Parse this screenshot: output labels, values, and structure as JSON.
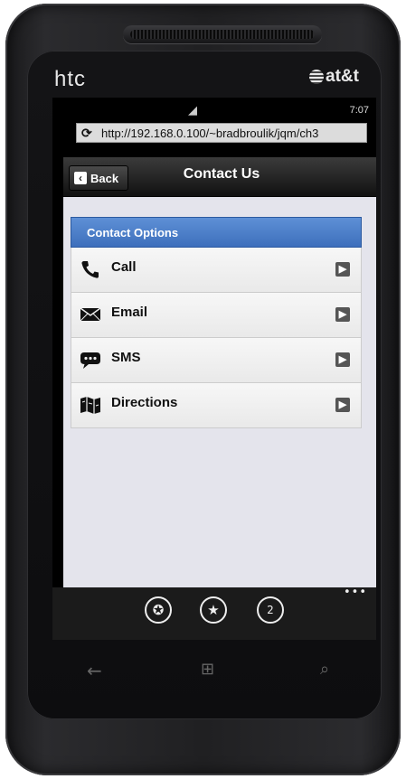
{
  "device": {
    "brand_left": "htc",
    "brand_right": "at&t"
  },
  "status": {
    "time": "7:07"
  },
  "browser": {
    "url": "http://192.168.0.100/~bradbroulik/jqm/ch3"
  },
  "header": {
    "back_label": "Back",
    "title": "Contact Us"
  },
  "list": {
    "divider": "Contact Options",
    "items": [
      {
        "label": "Call",
        "icon": "phone-icon"
      },
      {
        "label": "Email",
        "icon": "envelope-icon"
      },
      {
        "label": "SMS",
        "icon": "chat-bubble-icon"
      },
      {
        "label": "Directions",
        "icon": "map-icon"
      }
    ]
  },
  "appbar": {
    "buttons": [
      "add-favorite-icon",
      "favorites-icon",
      "tabs-icon"
    ],
    "tabs_count": "2"
  },
  "colors": {
    "divider_blue": "#4a7cc7",
    "header_dark": "#1e1e1e",
    "content_bg": "#e4e4ec"
  }
}
